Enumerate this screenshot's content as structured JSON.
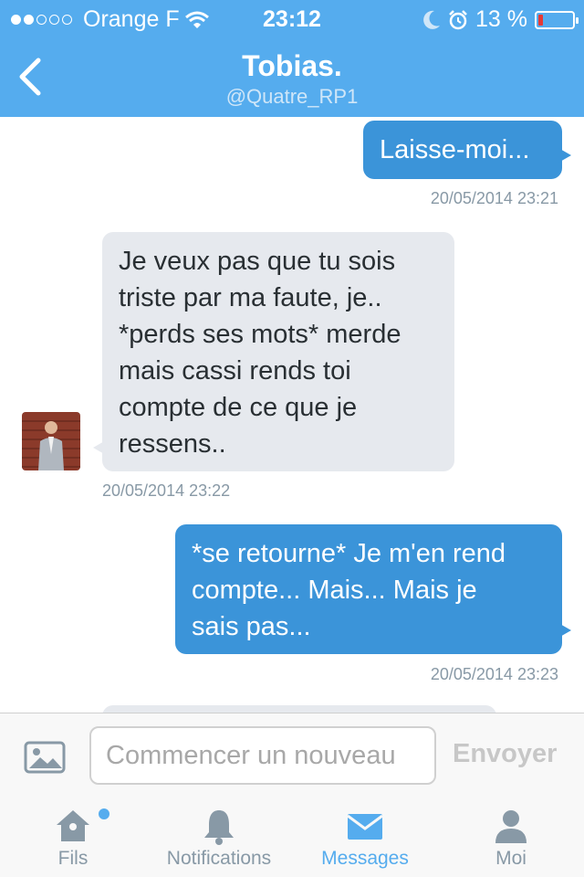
{
  "status_bar": {
    "carrier": "Orange F",
    "time": "23:12",
    "battery": "13 %",
    "battery_level": 0.13,
    "battery_color": "#e53935"
  },
  "header": {
    "title": "Tobias.",
    "handle": "@Quatre_RP1",
    "back_icon": "chevron-left-icon",
    "color": "#55acee"
  },
  "messages": [
    {
      "direction": "out",
      "text": "Laisse-moi...",
      "timestamp": "20/05/2014 23:21"
    },
    {
      "direction": "in",
      "lines": [
        "Je veux pas que tu sois",
        "triste par ma faute, je..",
        "*perds ses mots* merde",
        "mais cassi rends toi",
        "compte de ce que je",
        "ressens.."
      ],
      "timestamp": "20/05/2014 23:22"
    },
    {
      "direction": "out",
      "lines": [
        "*se retourne* Je m'en rend",
        "compte... Mais... Mais je",
        "sais pas..."
      ],
      "timestamp": "20/05/2014 23:23"
    }
  ],
  "composer": {
    "placeholder": "Commencer un nouveau",
    "send_label": "Envoyer",
    "photo_icon": "image-icon"
  },
  "tabs": [
    {
      "label": "Fils",
      "icon": "home-icon",
      "active": false,
      "notification_dot": true
    },
    {
      "label": "Notifications",
      "icon": "bell-icon",
      "active": false
    },
    {
      "label": "Messages",
      "icon": "envelope-icon",
      "active": true
    },
    {
      "label": "Moi",
      "icon": "person-icon",
      "active": false
    }
  ]
}
